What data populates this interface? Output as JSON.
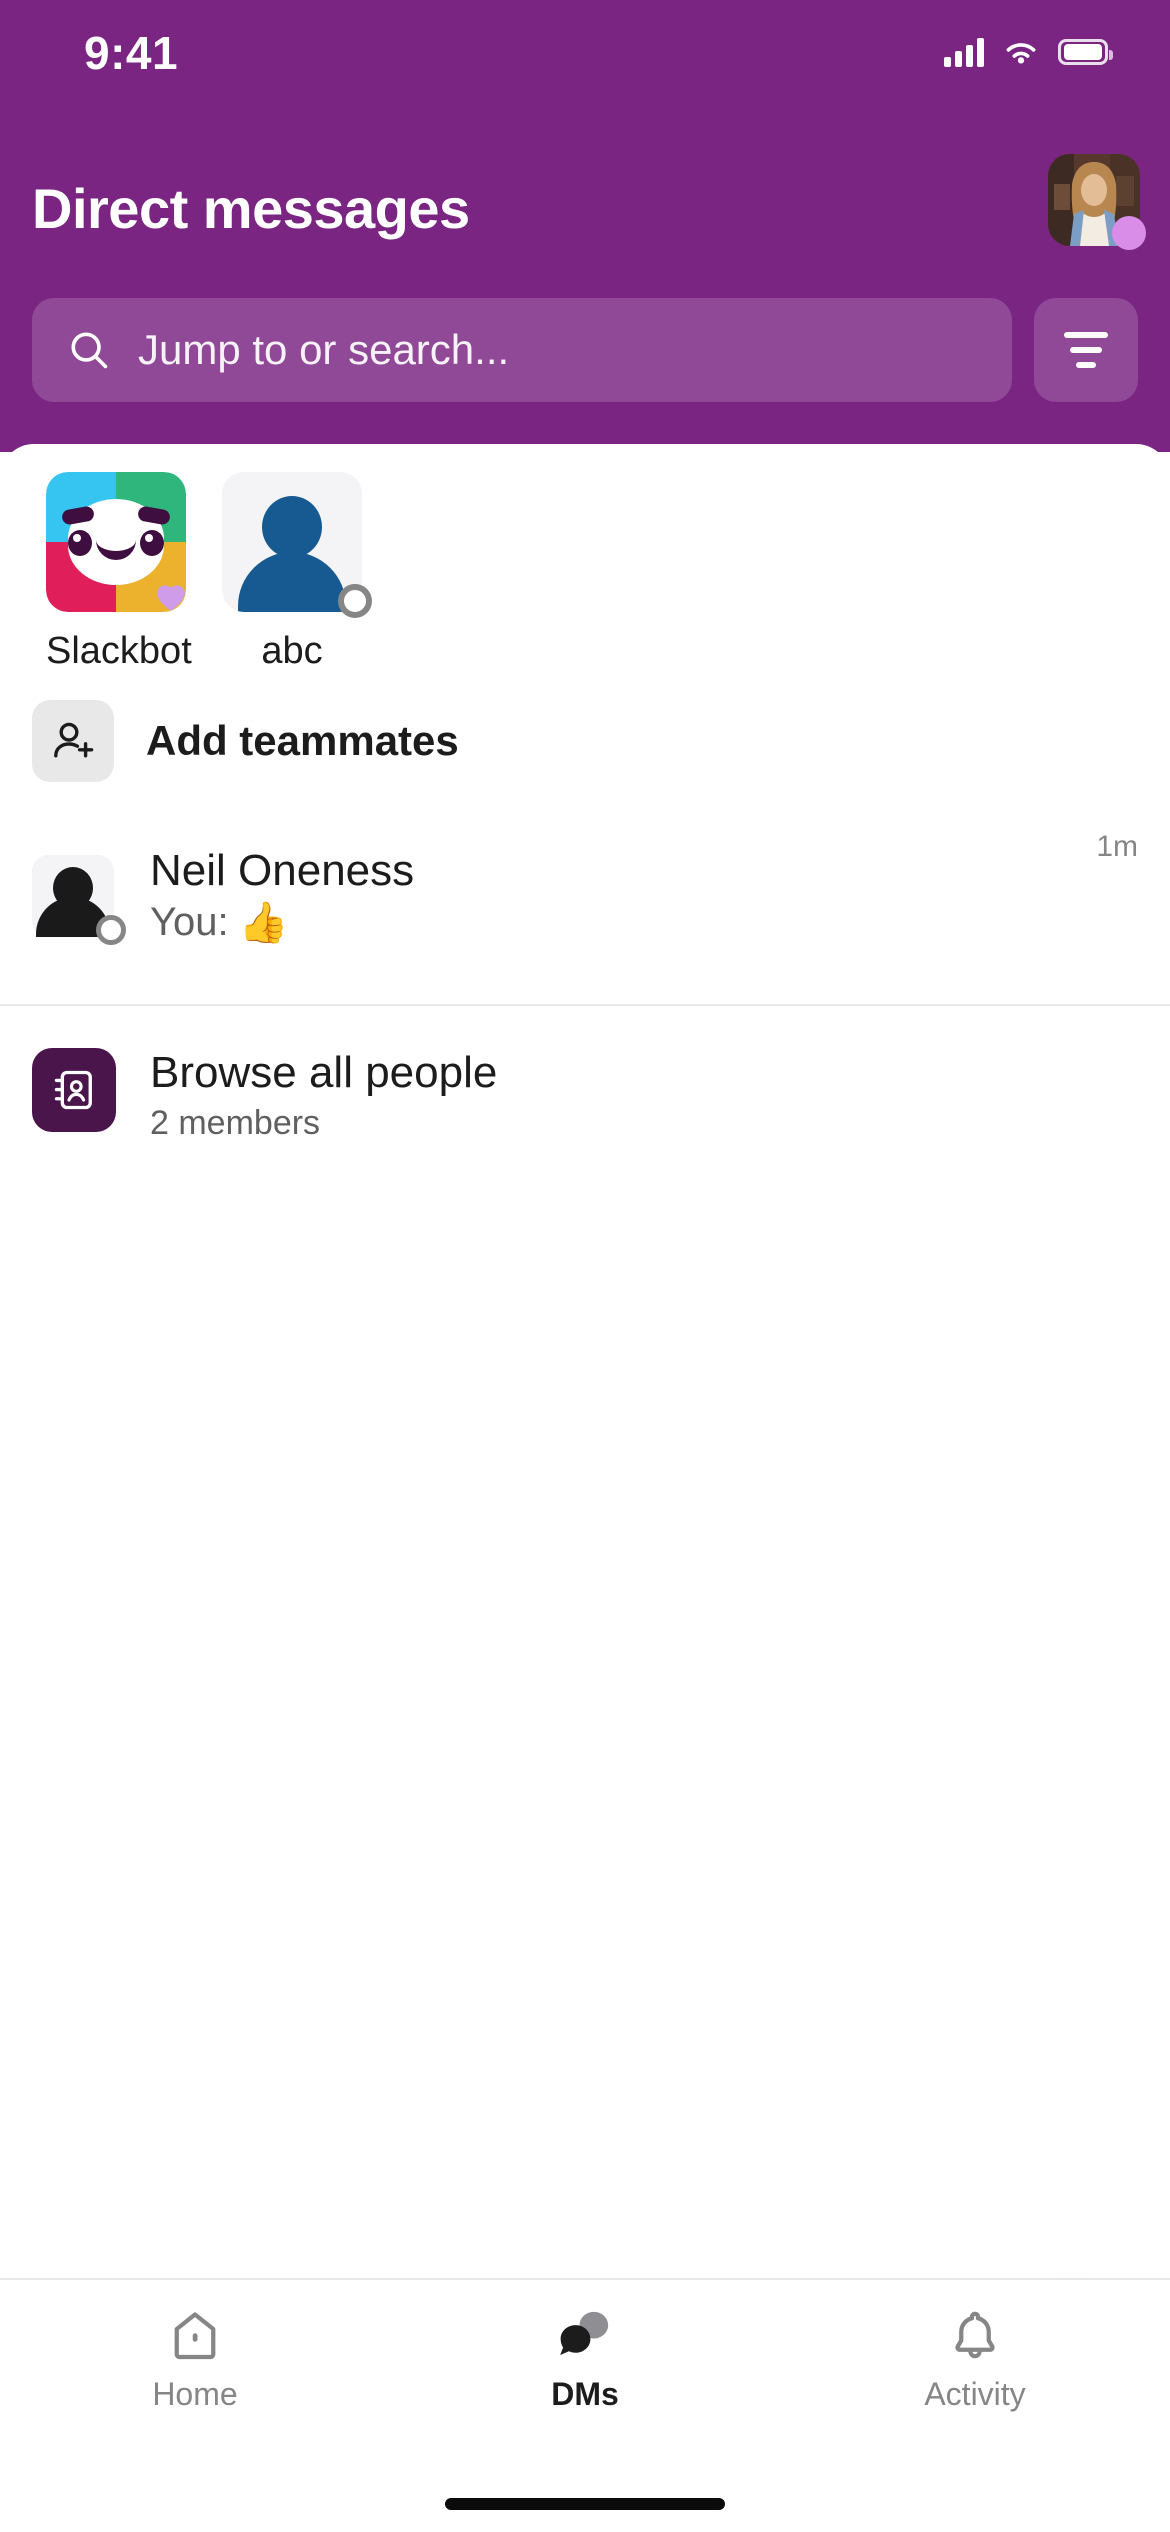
{
  "status_bar": {
    "time": "9:41",
    "cellular_icon": "signal-bars-icon",
    "wifi_icon": "wifi-icon",
    "battery_icon": "battery-icon"
  },
  "header": {
    "title": "Direct messages",
    "background_color": "#7A2582",
    "avatar_name": "user-avatar",
    "presence_color": "#D98CE8"
  },
  "search": {
    "placeholder": "Jump to or search...",
    "icon": "search-icon",
    "filter_icon": "filter-icon"
  },
  "quick_access": [
    {
      "label": "Slackbot",
      "icon": "slackbot-avatar",
      "badge": "purple-heart-badge"
    },
    {
      "label": "abc",
      "icon": "person-avatar",
      "presence": "offline"
    }
  ],
  "add_teammates": {
    "label": "Add teammates",
    "icon": "person-add-icon"
  },
  "conversations": [
    {
      "name": "Neil Oneness",
      "preview_prefix": "You:",
      "preview_emoji": "👍",
      "time": "1m",
      "avatar": "person-silhouette-avatar",
      "presence": "offline"
    }
  ],
  "browse_all": {
    "title": "Browse all people",
    "subtitle": "2 members",
    "icon": "address-book-icon",
    "icon_color": "#4A154B"
  },
  "compose": {
    "icon": "compose-pencil-icon",
    "color": "#4A154B"
  },
  "tabbar": {
    "items": [
      {
        "label": "Home",
        "icon": "home-icon",
        "active": false
      },
      {
        "label": "DMs",
        "icon": "chat-bubbles-icon",
        "active": true
      },
      {
        "label": "Activity",
        "icon": "bell-icon",
        "active": false
      }
    ]
  }
}
